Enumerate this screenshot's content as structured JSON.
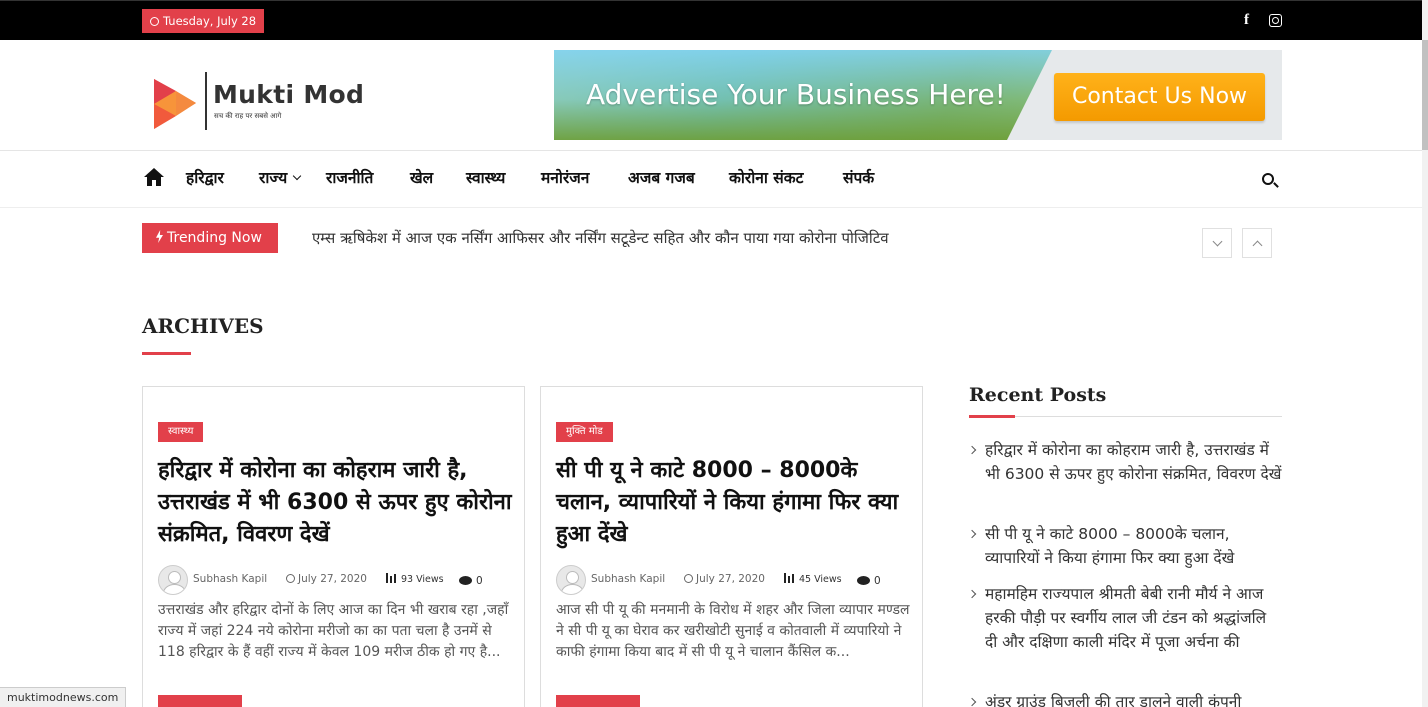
{
  "topbar": {
    "date": "Tuesday, July 28",
    "social": [
      "facebook-icon",
      "instagram-icon"
    ]
  },
  "logo": {
    "title": "Mukti Mod",
    "tagline": "सच की राह पर सबसे आगे"
  },
  "ad": {
    "text": "Advertise Your Business Here!",
    "cta": "Contact Us Now"
  },
  "nav": {
    "items": [
      "हरिद्वार",
      "राज्य",
      "राजनीति",
      "खेल",
      "स्वास्थ्य",
      "मनोरंजन",
      "अजब गजब",
      "कोरोना संकट",
      "संपर्क"
    ]
  },
  "trending": {
    "label": "Trending Now",
    "headline": "एम्स ऋषिकेश में आज एक नर्सिंग आफिसर और नर्सिंग सटूडेन्ट सहित और कौन पाया गया कोरोना पोजिटिव"
  },
  "archives": {
    "title": "ARCHIVES"
  },
  "posts": [
    {
      "category": "स्वास्थ्य",
      "title": "हरिद्वार में कोरोना का कोहराम जारी है, उत्तराखंड में भी 6300 से ऊपर हुए कोरोना संक्रमित, विवरण देखें",
      "author": "Subhash Kapil",
      "date": "July 27, 2020",
      "views": "93 Views",
      "comments": "0",
      "excerpt": "उत्तराखंड और हरिद्वार दोनों के लिए आज का दिन भी खराब रहा ,जहाँ राज्य में जहां 224 नये कोरोना मरीजो का का पता चला है उनमें से 118 हरिद्वार के हैं वहीं राज्य में केवल 109 मरीज ठीक हो गए है..."
    },
    {
      "category": "मुक्ति मोड",
      "title": "सी पी यू ने काटे 8000 – 8000के चलान, व्यापारियों ने किया हंगामा फिर क्या हुआ देंखे",
      "author": "Subhash Kapil",
      "date": "July 27, 2020",
      "views": "45 Views",
      "comments": "0",
      "excerpt": "आज सी पी यू की  मनमानी के विरोध में  शहर और जिला व्यापार मण्डल ने सी पी यू का घेराव कर खरीखोटी सुनाई व कोतवाली में व्यपारियो ने काफी हंगामा किया बाद में सी पी यू ने चालान कैंसिल क..."
    }
  ],
  "sidebar": {
    "title": "Recent Posts",
    "items": [
      "हरिद्वार में कोरोना का कोहराम जारी है, उत्तराखंड में भी 6300 से ऊपर हुए कोरोना संक्रमित, विवरण देखें",
      "सी पी यू ने काटे 8000 – 8000के चलान, व्यापारियों ने किया हंगामा फिर क्या हुआ देंखे",
      "महामहिम राज्यपाल श्रीमती बेबी रानी मौर्य ने आज हरकी पौड़ी पर स्वर्गीय लाल जी टंडन को श्रद्धांजलि दी और दक्षिणा काली मंदिर में पूजा अर्चना की",
      "अंडर ग्राउंड बिजली की तार डालने वाली कंपनी"
    ]
  },
  "status": {
    "url": "muktimodnews.com"
  },
  "colors": {
    "accent": "#e2404a",
    "topbar": "#000000",
    "cta": "#f7a300"
  }
}
